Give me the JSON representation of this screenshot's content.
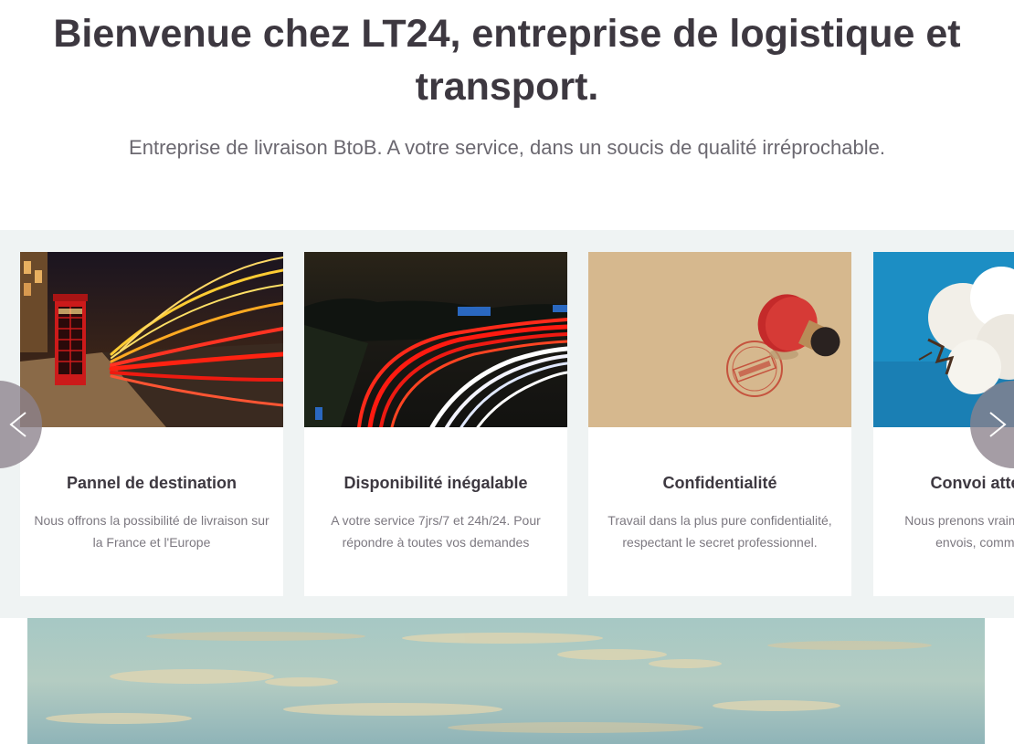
{
  "hero": {
    "title": "Bienvenue chez LT24, entreprise de logistique et transport.",
    "subtitle": "Entreprise de livraison BtoB. A votre service, dans un soucis de qualité irréprochable."
  },
  "carousel": {
    "cards": [
      {
        "image": "london-street-light-trails-phone-booth",
        "title": "Pannel de destination",
        "description": "Nous offrons la possibilité de livraison sur la France et l'Europe"
      },
      {
        "image": "highway-night-light-trails",
        "title": "Disponibilité inégalable",
        "description": "A votre service 7jrs/7 et 24h/24. Pour répondre à toutes vos demandes"
      },
      {
        "image": "top-secret-stamp",
        "title": "Confidentialité",
        "description": "Travail dans la plus pure confidentialité, respectant le secret professionnel."
      },
      {
        "image": "cotton-flower-blue-background",
        "title": "Convoi attentionné",
        "description": "Nous prenons vraiment soin de vos envois, comme du coton"
      }
    ],
    "prev_icon": "chevron-left-icon",
    "next_icon": "chevron-right-icon"
  },
  "banner": {
    "image": "sky-clouds-banner"
  },
  "colors": {
    "text_dark": "#3d3840",
    "text_muted": "#7c7880",
    "carousel_bg": "#eff3f3",
    "nav_button": "#8c828c"
  }
}
